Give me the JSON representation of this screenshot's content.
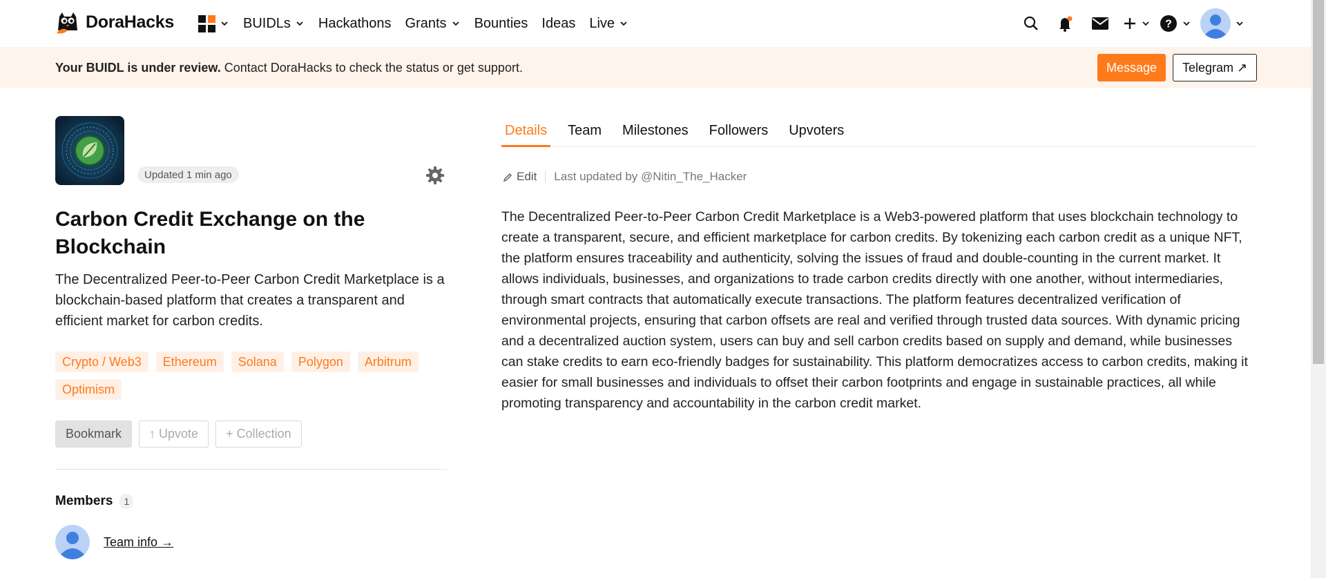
{
  "nav": {
    "brand": "DoraHacks",
    "items": [
      {
        "label": "BUIDLs",
        "dropdown": true
      },
      {
        "label": "Hackathons",
        "dropdown": false
      },
      {
        "label": "Grants",
        "dropdown": true
      },
      {
        "label": "Bounties",
        "dropdown": false
      },
      {
        "label": "Ideas",
        "dropdown": false
      },
      {
        "label": "Live",
        "dropdown": true
      }
    ],
    "right_icons": [
      "search-icon",
      "notification-bell-icon",
      "mail-icon",
      "plus-icon",
      "help-icon",
      "user-avatar"
    ],
    "accent_color": "#ff7a1a"
  },
  "banner": {
    "bold_text": "Your BUIDL is under review.",
    "rest_text": " Contact DoraHacks to check the status or get support.",
    "message_label": "Message",
    "telegram_label": "Telegram ↗"
  },
  "project": {
    "updated": "Updated 1 min ago",
    "title": "Carbon Credit Exchange on the Blockchain",
    "description": "The Decentralized Peer-to-Peer Carbon Credit Marketplace is a blockchain-based platform that creates a transparent and efficient market for carbon credits.",
    "tags": [
      "Crypto / Web3",
      "Ethereum",
      "Solana",
      "Polygon",
      "Arbitrum",
      "Optimism"
    ],
    "actions": {
      "bookmark": "Bookmark",
      "upvote": "↑ Upvote",
      "collection": "+ Collection"
    },
    "members_title": "Members",
    "members_count": "1",
    "team_info": "Team info →"
  },
  "tabs": [
    {
      "label": "Details",
      "active": true
    },
    {
      "label": "Team",
      "active": false
    },
    {
      "label": "Milestones",
      "active": false
    },
    {
      "label": "Followers",
      "active": false
    },
    {
      "label": "Upvoters",
      "active": false
    }
  ],
  "details": {
    "edit_label": "Edit",
    "last_updated": "Last updated by @Nitin_The_Hacker",
    "body": "The Decentralized Peer-to-Peer Carbon Credit Marketplace is a Web3-powered platform that uses blockchain technology to create a transparent, secure, and efficient marketplace for carbon credits. By tokenizing each carbon credit as a unique NFT, the platform ensures traceability and authenticity, solving the issues of fraud and double-counting in the current market. It allows individuals, businesses, and organizations to trade carbon credits directly with one another, without intermediaries, through smart contracts that automatically execute transactions. The platform features decentralized verification of environmental projects, ensuring that carbon offsets are real and verified through trusted data sources. With dynamic pricing and a decentralized auction system, users can buy and sell carbon credits based on supply and demand, while businesses can stake credits to earn eco-friendly badges for sustainability. This platform democratizes access to carbon credits, making it easier for small businesses and individuals to offset their carbon footprints and engage in sustainable practices, all while promoting transparency and accountability in the carbon credit market."
  }
}
